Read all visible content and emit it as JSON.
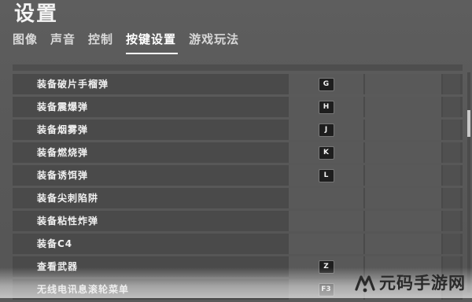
{
  "header": {
    "title": "设置"
  },
  "tabs": [
    {
      "label": "图像",
      "active": false
    },
    {
      "label": "声音",
      "active": false
    },
    {
      "label": "控制",
      "active": false
    },
    {
      "label": "按键设置",
      "active": true
    },
    {
      "label": "游戏玩法",
      "active": false
    }
  ],
  "bindings": [
    {
      "action": "装备破片手榴弹",
      "primary_key": "G",
      "secondary_key": ""
    },
    {
      "action": "装备震爆弹",
      "primary_key": "H",
      "secondary_key": ""
    },
    {
      "action": "装备烟雾弹",
      "primary_key": "J",
      "secondary_key": ""
    },
    {
      "action": "装备燃烧弹",
      "primary_key": "K",
      "secondary_key": ""
    },
    {
      "action": "装备诱饵弹",
      "primary_key": "L",
      "secondary_key": ""
    },
    {
      "action": "装备尖刺陷阱",
      "primary_key": "",
      "secondary_key": ""
    },
    {
      "action": "装备粘性炸弹",
      "primary_key": "",
      "secondary_key": ""
    },
    {
      "action": "装备C4",
      "primary_key": "",
      "secondary_key": ""
    },
    {
      "action": "查看武器",
      "primary_key": "Z",
      "secondary_key": ""
    },
    {
      "action": "无线电讯息滚轮菜单",
      "primary_key": "F3",
      "secondary_key": ""
    }
  ],
  "watermark": {
    "text": "元码手游网"
  },
  "colors": {
    "background": "#5a5a5a",
    "row_background": "#4a4a4a",
    "cell_background": "#595959",
    "keycap_background": "#1e1e1e",
    "active_tab_underline": "#ffffff"
  }
}
